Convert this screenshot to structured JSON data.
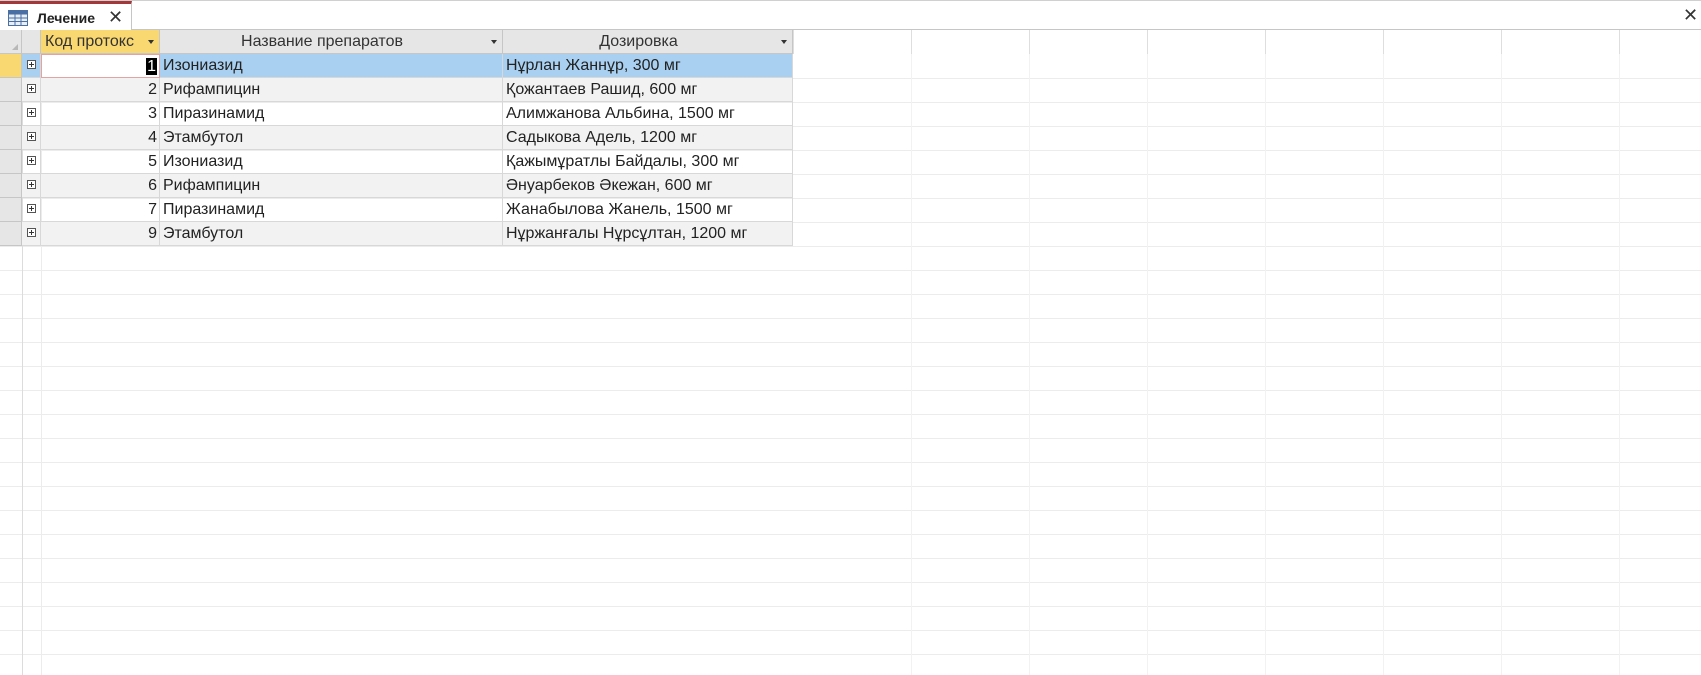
{
  "tab": {
    "title": "Лечение",
    "icon": "table-icon"
  },
  "window": {
    "close_icon": "close-icon"
  },
  "columns": [
    {
      "label": "Код протокс"
    },
    {
      "label": "Название препаратов"
    },
    {
      "label": "Дозировка"
    }
  ],
  "rows": [
    {
      "code": "1",
      "name": "Изониазид",
      "dose": "Нұрлан Жаннұр, 300 мг"
    },
    {
      "code": "2",
      "name": "Рифампицин",
      "dose": "Қожантаев Рашид, 600 мг"
    },
    {
      "code": "3",
      "name": "Пиразинамид",
      "dose": "Алимжанова Альбина, 1500 мг"
    },
    {
      "code": "4",
      "name": "Этамбутол",
      "dose": "Садыкова Адель, 1200 мг"
    },
    {
      "code": "5",
      "name": "Изониазид",
      "dose": "Қажымұратлы Байдалы, 300 мг"
    },
    {
      "code": "6",
      "name": "Рифампицин",
      "dose": "Әнуарбеков Әкежан, 600 мг"
    },
    {
      "code": "7",
      "name": "Пиразинамид",
      "dose": "Жанабылова Жанель, 1500 мг"
    },
    {
      "code": "9",
      "name": "Этамбутол",
      "dose": "Нұржанғалы Нұрсұлтан,  1200 мг"
    }
  ],
  "colors": {
    "selected_header": "#f9d771",
    "selected_row": "#a9d0f1",
    "tab_accent": "#a4373a"
  }
}
